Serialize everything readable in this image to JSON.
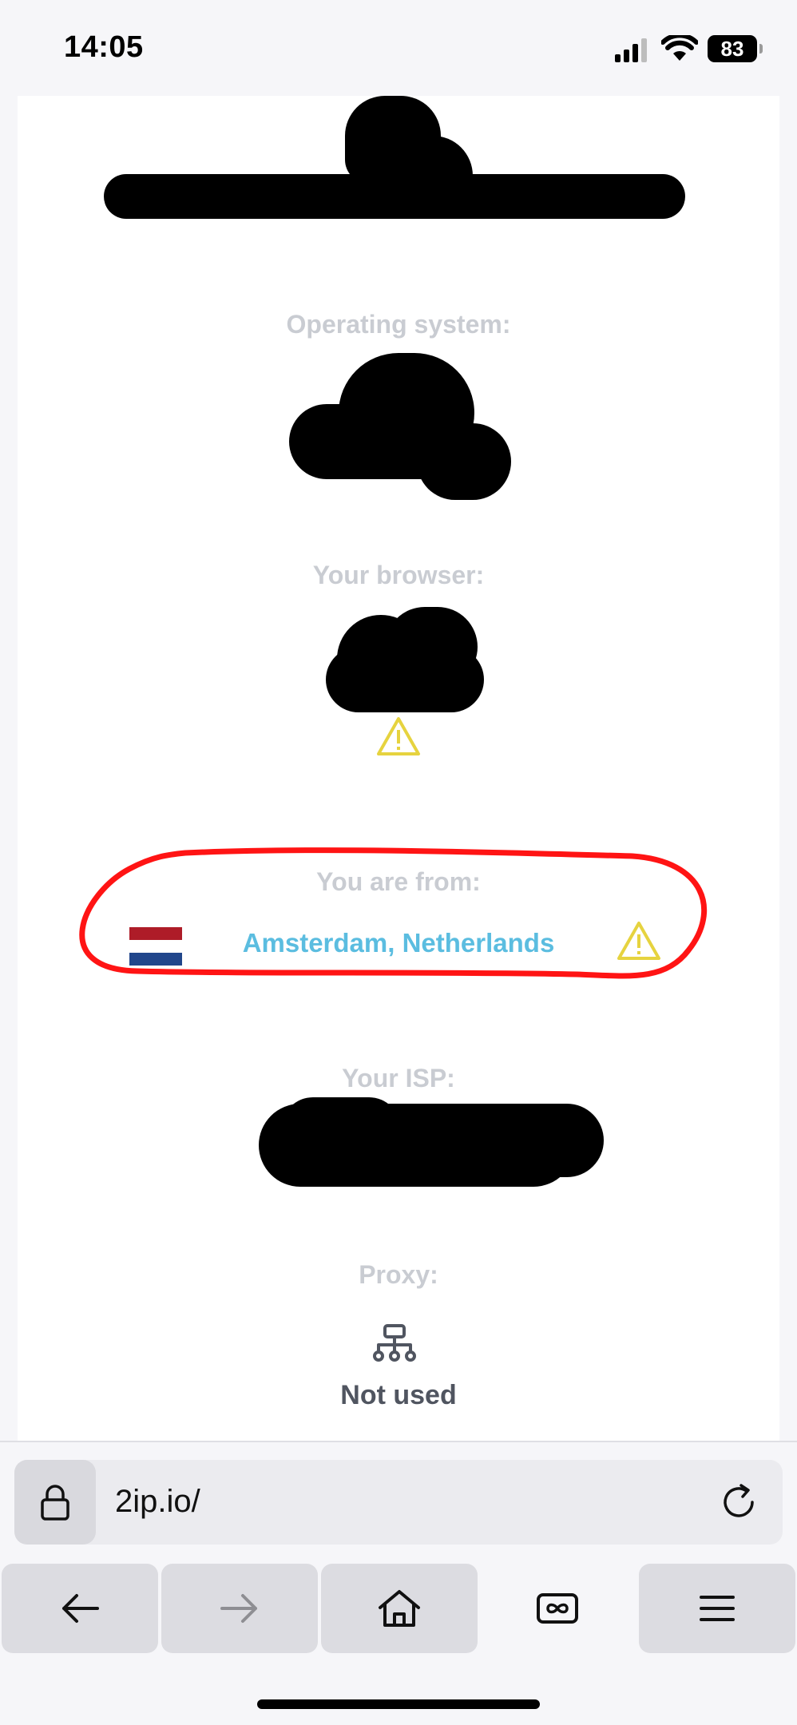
{
  "status_bar": {
    "time": "14:05",
    "battery": "83",
    "icons": [
      "signal-icon",
      "wifi-icon",
      "battery-icon"
    ]
  },
  "content": {
    "os_label": "Operating system:",
    "browser_label": "Your browser:",
    "location_label": "You are from:",
    "location_value": "Amsterdam, Netherlands",
    "isp_label": "Your ISP:",
    "proxy_label": "Proxy:",
    "proxy_value": "Not used",
    "colors": {
      "label": "#c9ccd2",
      "location": "#5bbde0",
      "warning": "#e6d33f",
      "highlight": "#ff0000",
      "flag": [
        "#ae1c28",
        "#ffffff",
        "#21468b"
      ]
    },
    "icons": [
      "warning-icon",
      "netherlands-flag-icon",
      "network-icon"
    ]
  },
  "browser": {
    "url": "2ip.io/",
    "icons": [
      "lock-icon",
      "reload-icon",
      "back-icon",
      "forward-icon",
      "home-icon",
      "tabs-icon",
      "menu-icon"
    ]
  }
}
